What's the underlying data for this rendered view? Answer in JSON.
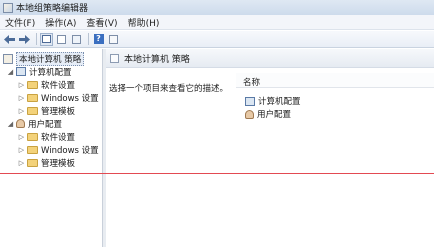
{
  "window": {
    "title": "本地组策略编辑器"
  },
  "menu": [
    "文件(F)",
    "操作(A)",
    "查看(V)",
    "帮助(H)"
  ],
  "toolbar": {
    "icons": [
      "back-arrow-icon",
      "forward-arrow-icon",
      "show-tree-icon",
      "properties-icon",
      "export-list-icon",
      "help-icon",
      "console-icon"
    ],
    "help_glyph": "?"
  },
  "tree": {
    "root": "本地计算机 策略",
    "computer_config": {
      "label": "计算机配置",
      "children": [
        "软件设置",
        "Windows 设置",
        "管理模板"
      ]
    },
    "user_config": {
      "label": "用户配置",
      "children": [
        "软件设置",
        "Windows 设置",
        "管理模板"
      ]
    }
  },
  "right": {
    "header_title": "本地计算机 策略",
    "description": "选择一个项目来查看它的描述。",
    "column_name": "名称",
    "items": [
      "计算机配置",
      "用户配置"
    ]
  },
  "colors": {
    "divider_line": "#e34a52",
    "folder": "#f3d27a"
  }
}
